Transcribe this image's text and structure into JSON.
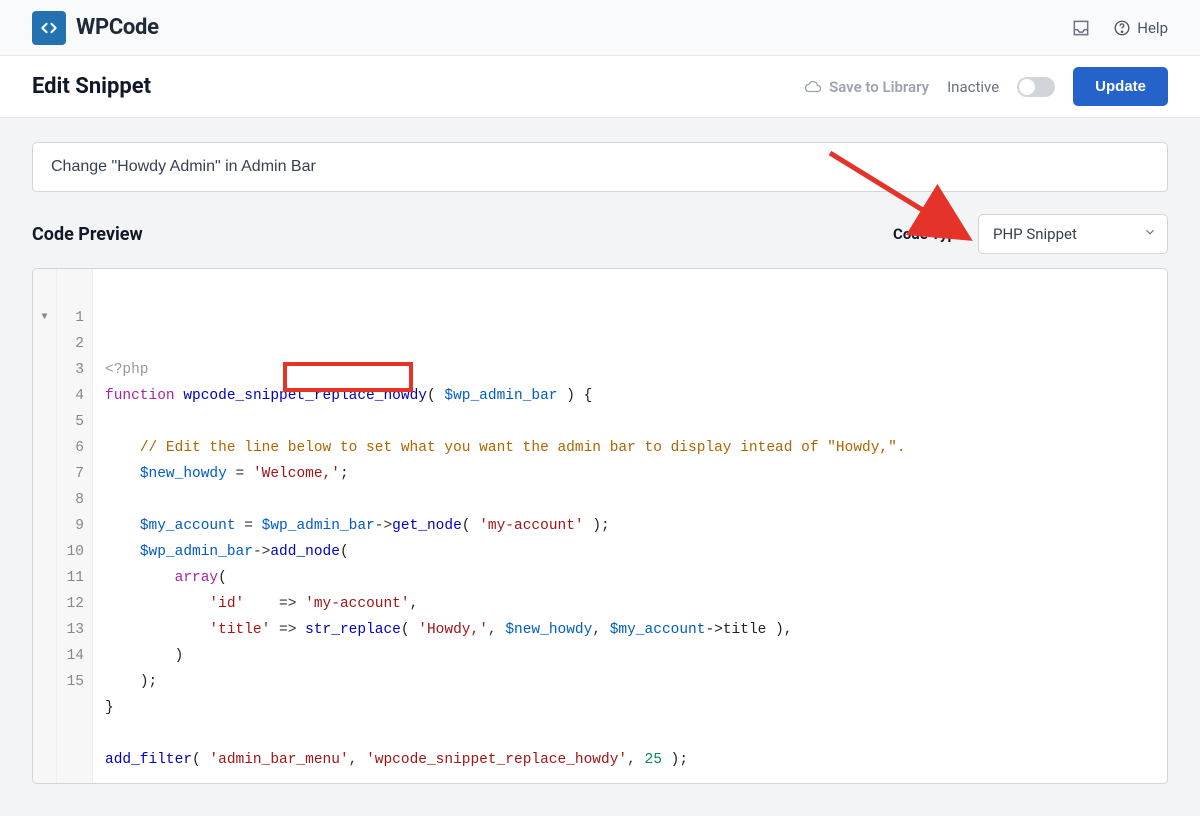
{
  "topbar": {
    "brand": "WPCode",
    "help_label": "Help"
  },
  "subheader": {
    "title": "Edit Snippet",
    "save_to_library": "Save to Library",
    "inactive_label": "Inactive",
    "update_label": "Update"
  },
  "snippet": {
    "title": "Change \"Howdy Admin\" in Admin Bar"
  },
  "preview": {
    "heading": "Code Preview",
    "code_type_label": "Code Type",
    "code_type_value": "PHP Snippet"
  },
  "code_tokens": [
    [
      {
        "t": "<?php",
        "c": "pre"
      }
    ],
    [
      {
        "t": "function",
        "c": "kw"
      },
      {
        "t": " "
      },
      {
        "t": "wpcode_snippet_replace_howdy",
        "c": "fn"
      },
      {
        "t": "( ",
        "c": "pun"
      },
      {
        "t": "$wp_admin_bar",
        "c": "var"
      },
      {
        "t": " ) {",
        "c": "pun"
      }
    ],
    [],
    [
      {
        "t": "    "
      },
      {
        "t": "// Edit the line below to set what you want the admin bar to display intead of \"Howdy,\".",
        "c": "cmt"
      }
    ],
    [
      {
        "t": "    "
      },
      {
        "t": "$new_howdy",
        "c": "var"
      },
      {
        "t": " = "
      },
      {
        "t": "'Welcome,'",
        "c": "str"
      },
      {
        "t": ";",
        "c": "pun"
      }
    ],
    [],
    [
      {
        "t": "    "
      },
      {
        "t": "$my_account",
        "c": "var"
      },
      {
        "t": " = "
      },
      {
        "t": "$wp_admin_bar",
        "c": "var"
      },
      {
        "t": "->"
      },
      {
        "t": "get_node",
        "c": "fn"
      },
      {
        "t": "( ",
        "c": "pun"
      },
      {
        "t": "'my-account'",
        "c": "str"
      },
      {
        "t": " );",
        "c": "pun"
      }
    ],
    [
      {
        "t": "    "
      },
      {
        "t": "$wp_admin_bar",
        "c": "var"
      },
      {
        "t": "->"
      },
      {
        "t": "add_node",
        "c": "fn"
      },
      {
        "t": "(",
        "c": "pun"
      }
    ],
    [
      {
        "t": "        "
      },
      {
        "t": "array",
        "c": "kw"
      },
      {
        "t": "(",
        "c": "pun"
      }
    ],
    [
      {
        "t": "            "
      },
      {
        "t": "'id'",
        "c": "str"
      },
      {
        "t": "    => "
      },
      {
        "t": "'my-account'",
        "c": "str"
      },
      {
        "t": ",",
        "c": "pun"
      }
    ],
    [
      {
        "t": "            "
      },
      {
        "t": "'title'",
        "c": "str"
      },
      {
        "t": " => "
      },
      {
        "t": "str_replace",
        "c": "fn"
      },
      {
        "t": "( ",
        "c": "pun"
      },
      {
        "t": "'Howdy,'",
        "c": "str"
      },
      {
        "t": ", "
      },
      {
        "t": "$new_howdy",
        "c": "var"
      },
      {
        "t": ", "
      },
      {
        "t": "$my_account",
        "c": "var"
      },
      {
        "t": "->title ),",
        "c": "pun"
      }
    ],
    [
      {
        "t": "        "
      },
      {
        "t": ")",
        "c": "pun"
      }
    ],
    [
      {
        "t": "    "
      },
      {
        "t": ");",
        "c": "pun"
      }
    ],
    [
      {
        "t": "}",
        "c": "pun"
      }
    ],
    [],
    [
      {
        "t": "add_filter",
        "c": "fn"
      },
      {
        "t": "( ",
        "c": "pun"
      },
      {
        "t": "'admin_bar_menu'",
        "c": "str"
      },
      {
        "t": ", "
      },
      {
        "t": "'wpcode_snippet_replace_howdy'",
        "c": "str"
      },
      {
        "t": ", "
      },
      {
        "t": "25",
        "c": "num"
      },
      {
        "t": " );",
        "c": "pun"
      }
    ]
  ]
}
